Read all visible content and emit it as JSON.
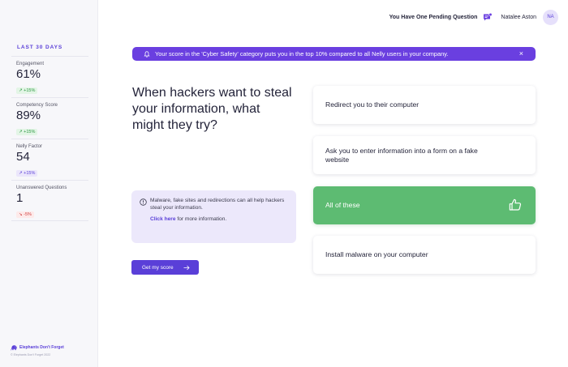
{
  "sidebar": {
    "period": "LAST 30 DAYS",
    "stats": [
      {
        "label": "Engagement",
        "value": "61%",
        "change": "↗ +15%"
      },
      {
        "label": "Competency Score",
        "value": "89%",
        "change": "↗ +15%"
      },
      {
        "label": "Nelly Factor",
        "value": "54",
        "change": "↗ +15%"
      },
      {
        "label": "Unanswered Questions",
        "value": "1",
        "change": "↘ -5%"
      }
    ],
    "brand": {
      "name": "Elephants Don't Forget",
      "copyright": "© Elephants Don't Forget 2022",
      "icon": "elephant-logo-icon"
    }
  },
  "header": {
    "pending": "You Have One Pending Question",
    "pending_icon": "chat-notification-icon",
    "username": "Natalee Aston",
    "avatar_initials": "NA"
  },
  "banner": {
    "text": "Your score in the 'Cyber Safety' category puts you in the top 10% compared to all Nelly users in your company.",
    "icon": "bell-icon",
    "close": "×"
  },
  "question": {
    "text": "When hackers want to steal your information, what might they try?"
  },
  "hint": {
    "text": "Malware, fake sites and redirections can all help hackers steal your information.",
    "link": "Click here",
    "link_suffix": " for more information.",
    "icon": "info-icon"
  },
  "cta": {
    "label": "Get my score",
    "icon": "arrow-right-icon"
  },
  "answers": [
    {
      "label": "Redirect you to their computer",
      "selected": false
    },
    {
      "label": "Ask you to enter information into a form on a fake website",
      "selected": false
    },
    {
      "label": "All of these",
      "selected": true,
      "icon": "thumbs-up-icon"
    },
    {
      "label": "Install malware on your computer",
      "selected": false
    }
  ],
  "colors": {
    "accent": "#5a3fd8",
    "banner": "#6a3fe0",
    "correct": "#5dbb72",
    "hint_bg": "#ece8fb"
  }
}
